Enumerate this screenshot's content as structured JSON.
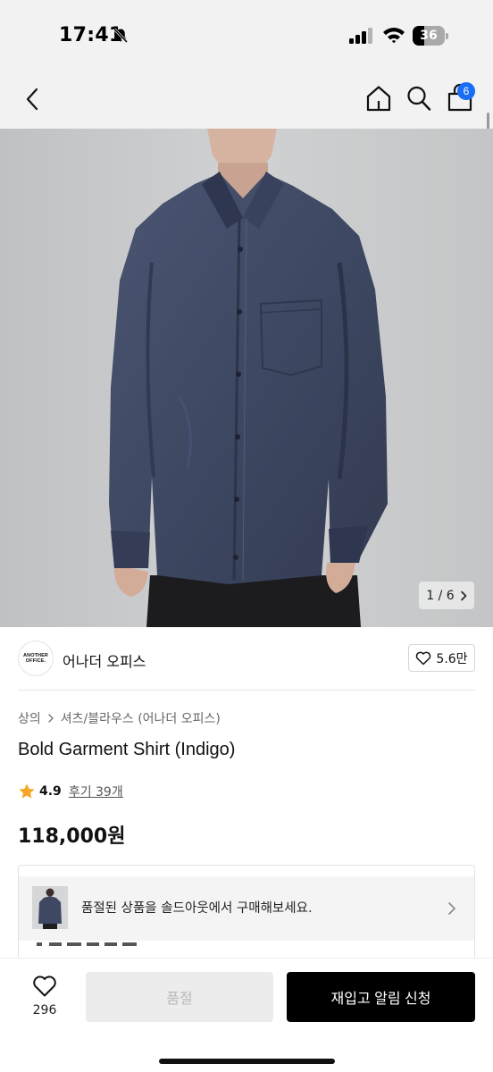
{
  "status_bar": {
    "time": "17:41",
    "battery": "36",
    "icons": [
      "bell-slash-icon",
      "cellular-signal-icon",
      "wifi-icon",
      "battery-icon"
    ]
  },
  "nav": {
    "cart_count": "6",
    "icons": [
      "chevron-left-icon",
      "home-icon",
      "search-icon",
      "shopping-bag-icon"
    ]
  },
  "gallery": {
    "counter": "1 / 6"
  },
  "brand": {
    "logo_line1": "ANOTHER",
    "logo_line2": "OFFICE.",
    "name": "어나더 오피스",
    "likes": "5.6만"
  },
  "breadcrumb": {
    "category": "상의",
    "subcategory": "셔츠/블라우스 (어나더 오피스)"
  },
  "product": {
    "name": "Bold Garment Shirt (Indigo)",
    "rating": "4.9",
    "reviews": "후기 39개",
    "price": "118,000원",
    "star_color": "#f5a623"
  },
  "soldout_banner": {
    "text": "품절된 상품을 솔드아웃에서 구매해보세요."
  },
  "bottom_bar": {
    "wish_count": "296",
    "soldout_label": "품절",
    "restock_label": "재입고 알림 신청"
  },
  "colors": {
    "accent_badge": "#1a6ef5",
    "primary_button": "#000000",
    "disabled_button": "#ececec"
  }
}
